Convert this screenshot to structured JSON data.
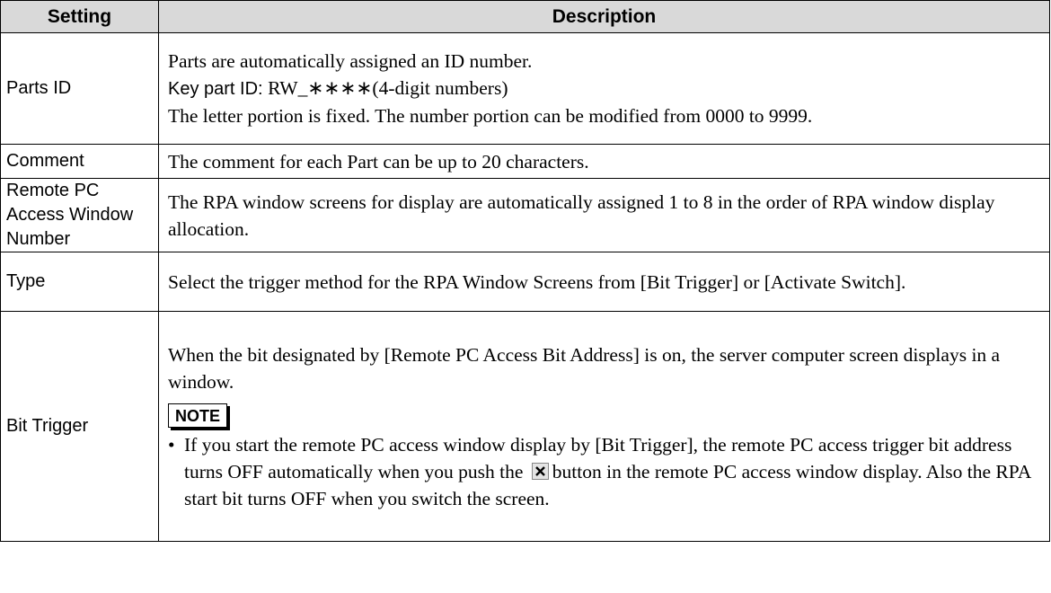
{
  "header": {
    "setting": "Setting",
    "description": "Description"
  },
  "rows": {
    "parts_id": {
      "setting": "Parts ID",
      "desc_line1": "Parts are automatically assigned an ID number.",
      "desc_line2_prefix": "Key part ID: ",
      "desc_line2_value": "RW_∗∗∗∗(4-digit numbers)",
      "desc_line3": "The letter portion is fixed. The number portion can be modified from 0000 to 9999."
    },
    "comment": {
      "setting": "Comment",
      "desc": "The comment for each Part can be up to 20 characters."
    },
    "window_number": {
      "setting": "Remote PC Access Window Number",
      "desc": "The RPA window screens for display are automatically assigned 1 to 8 in the order of RPA window display allocation."
    },
    "type": {
      "setting": "Type",
      "desc": "Select the trigger method for the RPA Window Screens from [Bit Trigger] or [Activate Switch]."
    },
    "bit_trigger": {
      "setting": "Bit Trigger",
      "desc": "When the bit designated by [Remote PC Access Bit Address] is on, the server computer screen displays in a window.",
      "note_label": "NOTE",
      "bullet": "•",
      "note_before_icon": "If you start the remote PC access window display by [Bit Trigger], the remote PC access trigger bit address turns OFF automatically when you push the",
      "note_icon": "close-icon",
      "note_after_icon": "button in the remote PC access window display. Also the RPA start bit turns OFF when you switch the screen."
    }
  }
}
